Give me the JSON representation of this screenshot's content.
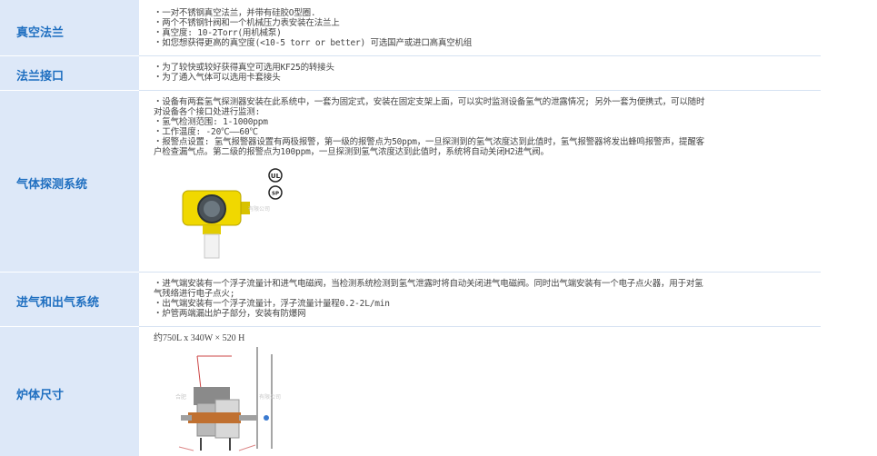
{
  "rows": [
    {
      "label": "真空法兰",
      "lines": [
        "・一对不锈钢真空法兰，并带有硅胶O型圈.",
        "・两个不锈钢针阀和一个机械压力表安装在法兰上",
        "・真空度: 10-2Torr(用机械泵)",
        "・如您想获得更高的真空度(<10-5 torr or better) 可选国产或进口高真空机组"
      ]
    },
    {
      "label": "法兰接口",
      "lines": [
        "・为了较快或较好获得真空可选用KF25的转接头",
        "・为了通入气体可以选用卡套接头"
      ]
    },
    {
      "label": "气体探测系统",
      "lines": [
        "・设备有两套氢气探测器安装在此系统中，一套为固定式，安装在固定支架上面，可以实时监测设备氢气的泄露情况; 另外一套为便携式，可以随时",
        "对设备各个接口处进行监测:",
        "・氢气检测范围: 1-1000ppm",
        "・工作温度: -20℃——60℃",
        "・报警点设置: 氢气报警器设置有两极报警，第一级的报警点为50ppm，一旦探测到的氢气浓度达到此值时，氢气报警器将发出蜂鸣报警声，提醒客",
        "户检查漏气点。第二级的报警点为100ppm，一旦探测到氢气浓度达到此值时，系统将自动关闭H2进气阀。"
      ],
      "image_caption": "有限公司"
    },
    {
      "label": "进气和出气系统",
      "lines": [
        "・进气端安装有一个浮子流量计和进气电磁阀，当检测系统检测到氢气泄露时将自动关闭进气电磁阀。同时出气端安装有一个电子点火器，用于对氢",
        "气残络进行电子点火;",
        "・出气端安装有一个浮子流量计，浮子流量计量程0.2-2L/min",
        "・炉管两端漏出炉子部分，安装有防爆网"
      ]
    },
    {
      "label": "炉体尺寸",
      "lines": [
        "约750L x 340W × 520 H"
      ],
      "image_caption_left": "合肥",
      "image_caption_right": "有限公司"
    }
  ],
  "colors": {
    "label_bg": "#dde8f8",
    "label_text": "#1f6fc0",
    "detector_yellow": "#f0d800"
  },
  "icons": [
    "ul-certification-icon",
    "csa-certification-icon"
  ]
}
